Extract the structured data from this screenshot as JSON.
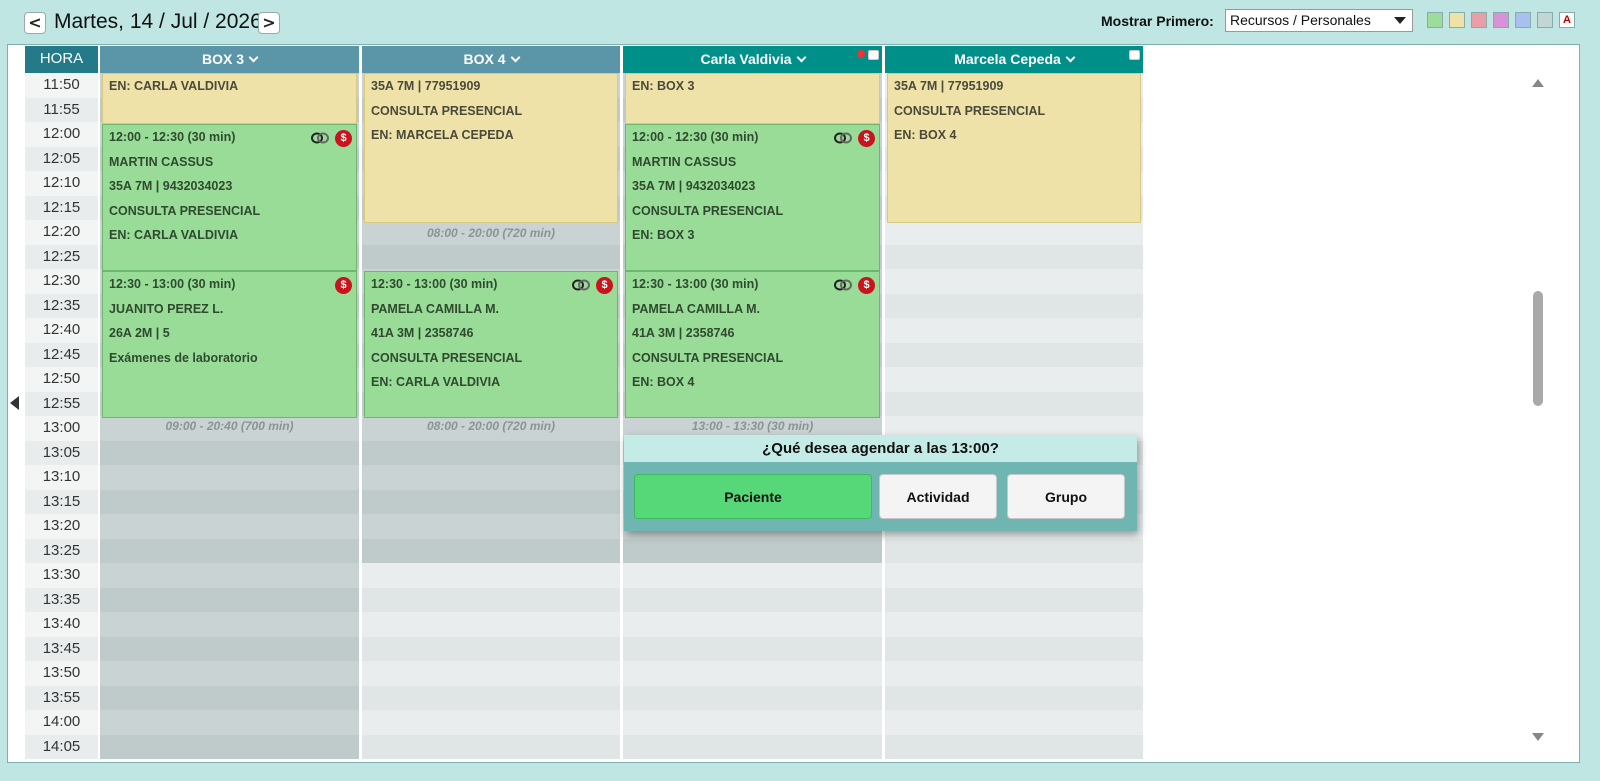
{
  "header": {
    "prev_label": "<",
    "next_label": ">",
    "date": "Martes, 14 / Jul / 2026",
    "mostrar_label": "Mostrar Primero:",
    "mostrar_value": "Recursos / Personales",
    "swatch_colors": [
      "#9ddc9b",
      "#efe2a9",
      "#e8a0a6",
      "#d892d6",
      "#a9c0ef",
      "#c2d6d4"
    ],
    "swatch_text": "A"
  },
  "grid": {
    "hora_label": "HORA",
    "times": [
      "11:50",
      "11:55",
      "12:00",
      "12:05",
      "12:10",
      "12:15",
      "12:20",
      "12:25",
      "12:30",
      "12:35",
      "12:40",
      "12:45",
      "12:50",
      "12:55",
      "13:00",
      "13:05",
      "13:10",
      "13:15",
      "13:20",
      "13:25",
      "13:30",
      "13:35",
      "13:40",
      "13:45",
      "13:50",
      "13:55",
      "14:00",
      "14:05"
    ]
  },
  "columns": [
    {
      "title": "BOX 3",
      "appointments": [
        {
          "lines": [
            "EN: CARLA VALDIVIA"
          ]
        },
        {
          "lines": [
            "12:00 - 12:30 (30 min)",
            "MARTIN CASSUS",
            "35A 7M | 9432034023",
            "CONSULTA PRESENCIAL",
            "EN: CARLA VALDIVIA"
          ]
        },
        {
          "lines": [
            "12:30 - 13:00 (30 min)",
            "JUANITO PEREZ L.",
            "26A 2M | 5",
            "Exámenes de laboratorio"
          ]
        }
      ],
      "range": "09:00 - 20:40 (700 min)"
    },
    {
      "title": "BOX 4",
      "appointments": [
        {
          "lines": [
            "35A 7M | 77951909",
            "CONSULTA PRESENCIAL",
            "EN: MARCELA CEPEDA"
          ]
        },
        {
          "lines": [
            "12:30 - 13:00 (30 min)",
            "PAMELA CAMILLA M.",
            "41A 3M | 2358746",
            "CONSULTA PRESENCIAL",
            "EN: CARLA VALDIVIA"
          ]
        }
      ],
      "range_top": "08:00 - 20:00 (720 min)",
      "range": "08:00 - 20:00 (720 min)"
    },
    {
      "title": "Carla Valdivia",
      "appointments": [
        {
          "lines": [
            "EN: BOX 3"
          ]
        },
        {
          "lines": [
            "12:00 - 12:30 (30 min)",
            "MARTIN CASSUS",
            "35A 7M | 9432034023",
            "CONSULTA PRESENCIAL",
            "EN: BOX 3"
          ]
        },
        {
          "lines": [
            "12:30 - 13:00 (30 min)",
            "PAMELA CAMILLA M.",
            "41A 3M | 2358746",
            "CONSULTA PRESENCIAL",
            "EN: BOX 4"
          ]
        }
      ],
      "range": "13:00 - 13:30 (30 min)"
    },
    {
      "title": "Marcela Cepeda",
      "appointments": [
        {
          "lines": [
            "35A 7M | 77951909",
            "CONSULTA PRESENCIAL",
            "EN: BOX 4"
          ]
        }
      ]
    }
  ],
  "badge_symbol": "$",
  "popup": {
    "title": "¿Qué desea agendar a las 13:00?",
    "btn_patient": "Paciente",
    "btn_activity": "Actividad",
    "btn_group": "Grupo"
  }
}
